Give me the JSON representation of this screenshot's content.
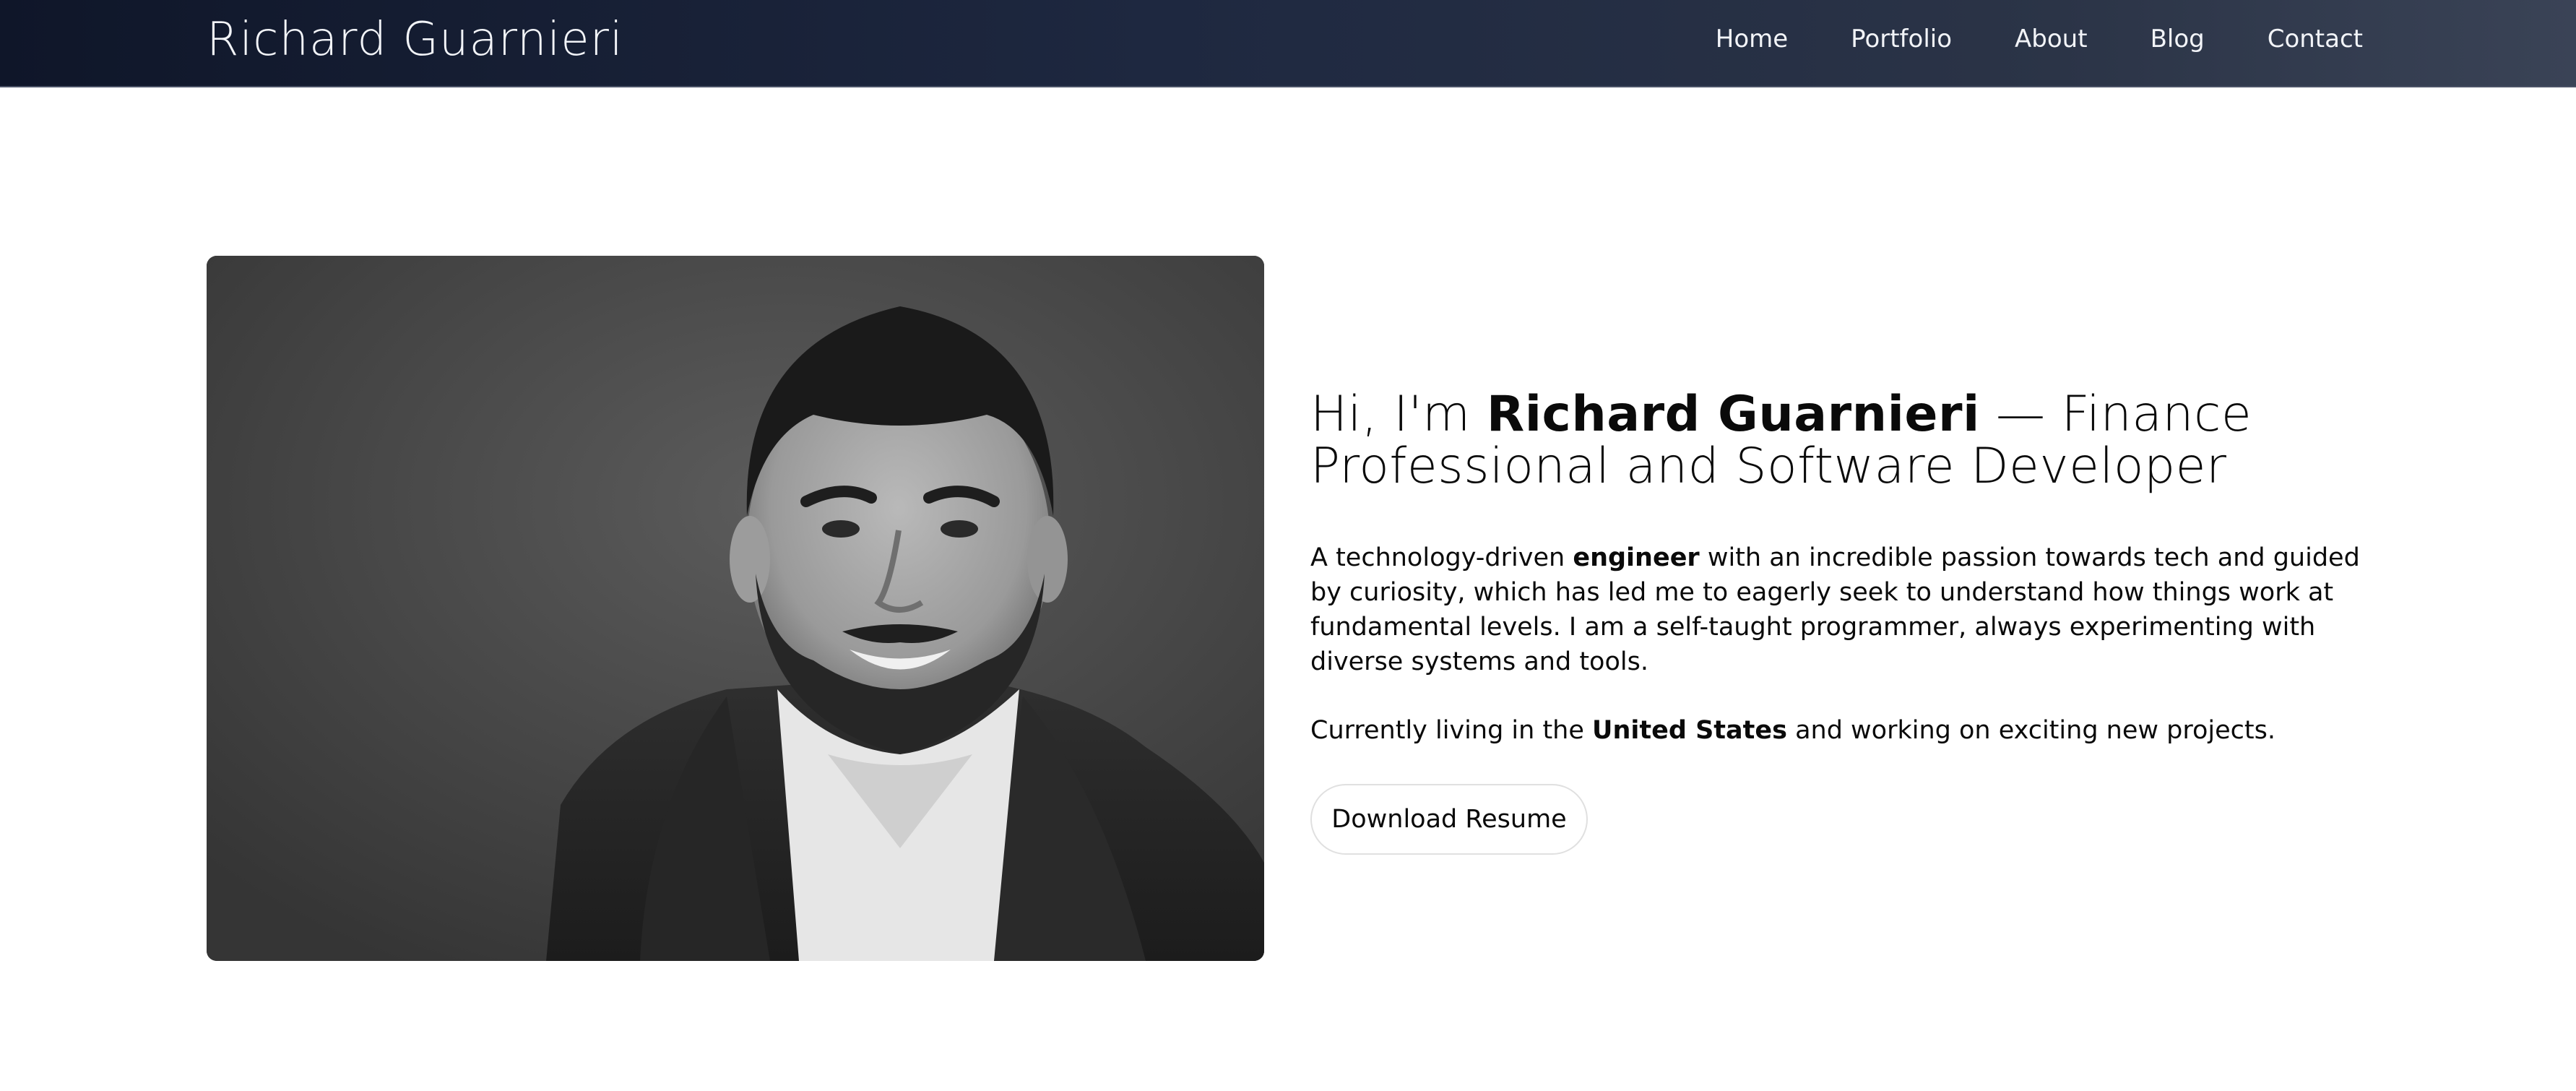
{
  "header": {
    "brand": "Richard Guarnieri",
    "nav": [
      "Home",
      "Portfolio",
      "About",
      "Blog",
      "Contact"
    ]
  },
  "hero": {
    "photo_alt": "Portrait of Richard Guarnieri",
    "headline_prefix": "Hi, I'm ",
    "headline_name": "Richard Guarnieri",
    "headline_suffix": " — Finance Professional and Software Developer",
    "p1_before": "A technology-driven ",
    "p1_bold": "engineer",
    "p1_after": " with an incredible passion towards tech and guided by curiosity, which has led me to eagerly seek to understand how things work at fundamental levels. I am a self-taught programmer, always experimenting with diverse systems and tools.",
    "p2_before": "Currently living in the ",
    "p2_bold": "United States",
    "p2_after": " and working on exciting new projects.",
    "cta_label": "Download Resume"
  },
  "colors": {
    "nav_gradient_start": "#0f1629",
    "nav_gradient_end": "#3a4356",
    "text": "#0a0a0a",
    "nav_text": "#f2f4f8",
    "button_border": "#e0e0e0"
  }
}
